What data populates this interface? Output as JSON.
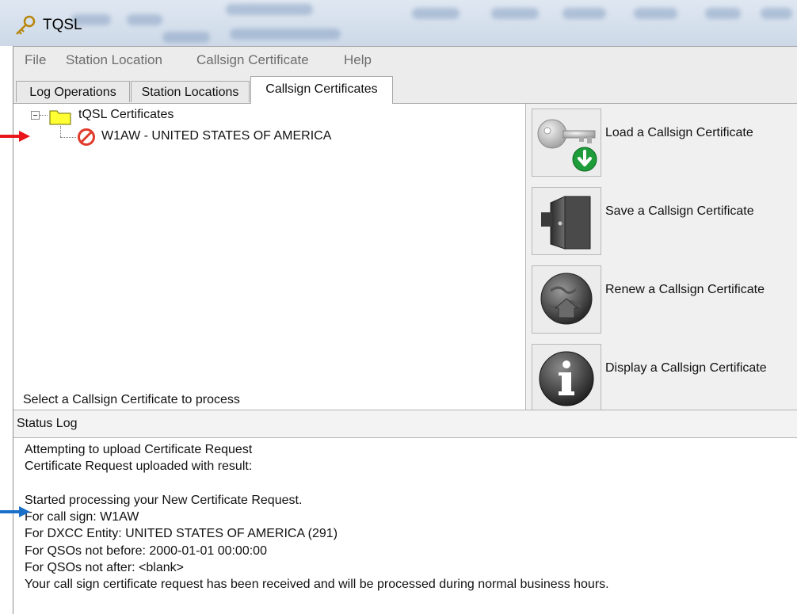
{
  "window": {
    "title": "TQSL"
  },
  "menu": [
    "File",
    "Station Location",
    "Callsign Certificate",
    "Help"
  ],
  "tabs": [
    {
      "label": "Log Operations",
      "active": false
    },
    {
      "label": "Station Locations",
      "active": false
    },
    {
      "label": "Callsign Certificates",
      "active": true
    }
  ],
  "tree": {
    "root_label": "tQSL Certificates",
    "items": [
      {
        "label": "W1AW - UNITED STATES OF AMERICA",
        "icon": "no-entry-icon"
      }
    ]
  },
  "hint": "Select a Callsign Certificate to process",
  "actions": [
    {
      "label": "Load a Callsign Certificate",
      "icon": "key-download-icon"
    },
    {
      "label": "Save a Callsign Certificate",
      "icon": "door-icon"
    },
    {
      "label": "Renew a Callsign Certificate",
      "icon": "globe-home-icon"
    },
    {
      "label": "Display a Callsign Certificate",
      "icon": "info-icon"
    }
  ],
  "status": {
    "title": "Status Log",
    "lines": [
      "Attempting to upload Certificate Request",
      "Certificate Request uploaded with result:",
      "",
      "Started processing your New Certificate Request.",
      "For call sign: W1AW",
      "For DXCC Entity: UNITED STATES OF AMERICA (291)",
      "For QSOs not before: 2000-01-01 00:00:00",
      "For QSOs not after: <blank>",
      "Your call sign certificate request has been received and will be processed during normal business hours."
    ]
  },
  "colors": {
    "annotation_red": "#e8151b",
    "annotation_blue": "#1a6fc8",
    "active_tab_bg": "#ffffff"
  }
}
